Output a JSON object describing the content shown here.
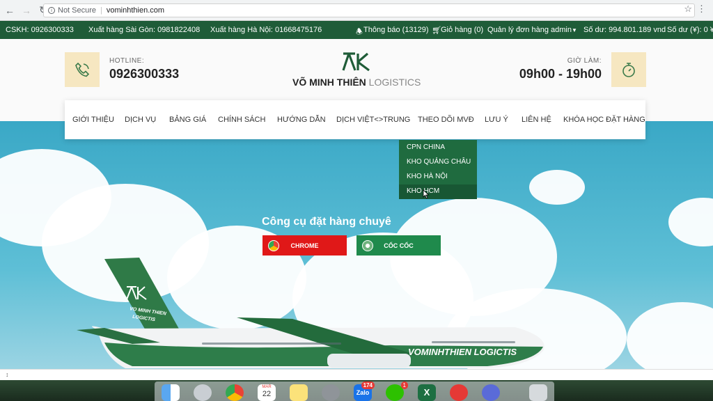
{
  "browser": {
    "security_label": "Not Secure",
    "url": "vominhthien.com"
  },
  "top_strip": {
    "cskh": "CSKH: 0926300333",
    "saigon": "Xuất hàng Sài Gòn: 0981822408",
    "hanoi": "Xuất hàng Hà Nội: 01668475176",
    "notifications": "Thông báo  (13129)",
    "cart": "Giỏ hàng (0)",
    "orders": "Quản lý đơn hàng",
    "user": "admin",
    "balance_vnd": "Số dư: 994.801.189 vnd",
    "balance_cny": "Số dư (¥): 0 ¥"
  },
  "header": {
    "hotline_label": "HOTLINE:",
    "hotline_number": "0926300333",
    "brand_bold": "VÕ MINH THIÊN",
    "brand_light": "LOGISTICS",
    "work_label": "GIỜ LÀM:",
    "work_hours": "09h00 - 19h00"
  },
  "nav": {
    "items": [
      "GIỚI THIỆU",
      "DỊCH VỤ",
      "BẢNG GIÁ",
      "CHÍNH SÁCH",
      "HƯỚNG DẪN",
      "DỊCH VIỆT<>TRUNG",
      "THEO DÕI MVĐ",
      "LƯU Ý",
      "LIÊN HỆ",
      "KHÓA HỌC ĐẶT HÀNG"
    ]
  },
  "dropdown": {
    "items": [
      "CPN CHINA",
      "KHO QUẢNG CHÂU",
      "KHO HÀ NỘI",
      "KHO HCM"
    ]
  },
  "hero": {
    "title": "Công cụ đặt hàng chuyê",
    "chrome_label": "CHROME",
    "coccoc_label": "CỐC CỐC",
    "plane_brand_line1": "VO MINH THIEN",
    "plane_brand_line2": "LOGICTIS",
    "plane_text": "VOMINHTHIEN LOGICTIS"
  },
  "dock": {
    "calendar_month": "MAR",
    "calendar_day": "22",
    "zalo_label": "Zalo",
    "zalo_badge": "174",
    "wechat_badge": "1"
  },
  "colors": {
    "brand_green": "#1f5c38",
    "chrome_red": "#e01818",
    "coccoc_green": "#1f8a4c",
    "header_icon_bg": "#f6e7c1"
  }
}
